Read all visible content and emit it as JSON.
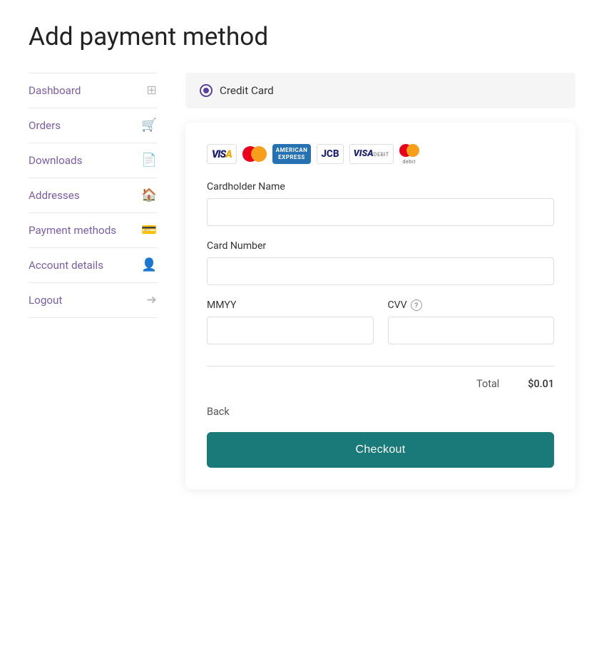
{
  "page": {
    "title": "Add payment method"
  },
  "sidebar": {
    "items": [
      {
        "id": "dashboard",
        "label": "Dashboard",
        "icon": "dashboard-icon",
        "active": false
      },
      {
        "id": "orders",
        "label": "Orders",
        "icon": "orders-icon",
        "active": false
      },
      {
        "id": "downloads",
        "label": "Downloads",
        "icon": "downloads-icon",
        "active": false
      },
      {
        "id": "addresses",
        "label": "Addresses",
        "icon": "addresses-icon",
        "active": false
      },
      {
        "id": "payment-methods",
        "label": "Payment methods",
        "icon": "payment-icon",
        "active": true
      },
      {
        "id": "account-details",
        "label": "Account details",
        "icon": "account-icon",
        "active": false
      },
      {
        "id": "logout",
        "label": "Logout",
        "icon": "logout-icon",
        "active": false
      }
    ]
  },
  "payment": {
    "method_label": "Credit Card",
    "cardholder_name_label": "Cardholder Name",
    "cardholder_name_placeholder": "",
    "card_number_label": "Card Number",
    "card_number_placeholder": "",
    "mmyy_label": "MMYY",
    "mmyy_placeholder": "",
    "cvv_label": "CVV",
    "cvv_placeholder": "",
    "total_label": "Total",
    "total_amount": "$0.01",
    "back_label": "Back",
    "checkout_label": "Checkout"
  }
}
